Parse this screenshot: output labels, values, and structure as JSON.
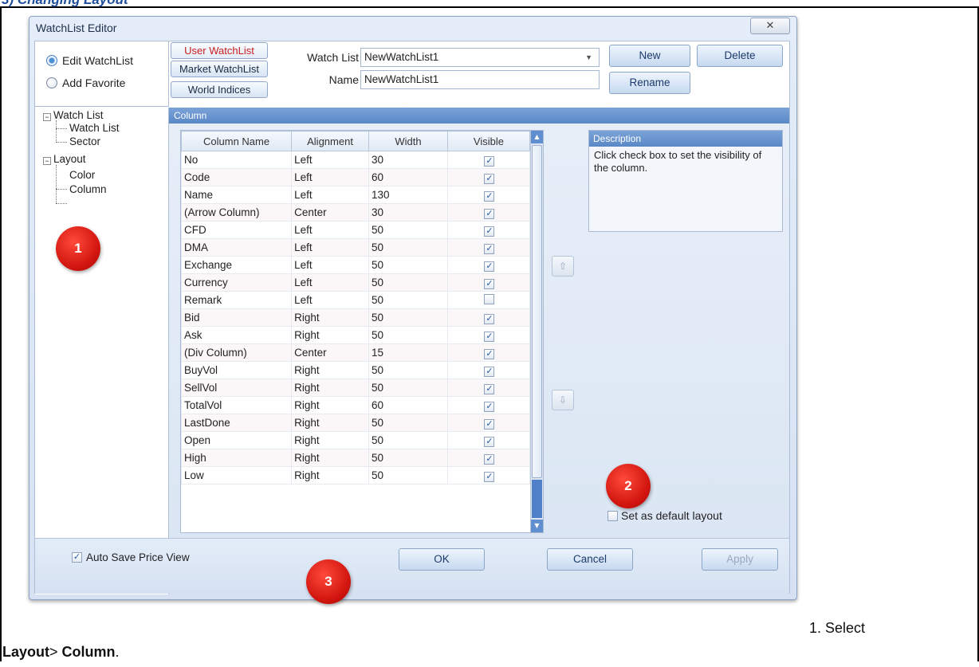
{
  "page": {
    "heading_fragment": "3) Changing Layout",
    "caption_step": "1. Select",
    "caption_path_bold1": "Layout",
    "caption_path_sep": ">",
    "caption_path_bold2": "Column",
    "caption_path_end": "."
  },
  "dialog": {
    "title": "WatchList Editor",
    "close_glyph": "✕",
    "radios": [
      {
        "label": "Edit WatchList",
        "checked": true
      },
      {
        "label": "Add Favorite",
        "checked": false
      }
    ],
    "tree": {
      "watch_list": "Watch List",
      "watch_list_child": "Watch List",
      "sector": "Sector",
      "layout": "Layout",
      "color": "Color",
      "column": "Column",
      "expander_glyph": "−"
    },
    "source_tabs": [
      "User WatchList",
      "Market WatchList",
      "World Indices"
    ],
    "watch_list_label": "Watch List",
    "watch_list_value": "NewWatchList1",
    "name_label": "Name",
    "name_value": "NewWatchList1",
    "buttons": {
      "new": "New",
      "delete": "Delete",
      "rename": "Rename",
      "ok": "OK",
      "cancel": "Cancel",
      "apply": "Apply"
    },
    "column_panel_title": "Column",
    "grid": {
      "headers": [
        "Column Name",
        "Alignment",
        "Width",
        "Visible"
      ],
      "rows": [
        {
          "name": "No",
          "align": "Left",
          "width": "30",
          "visible": true
        },
        {
          "name": "Code",
          "align": "Left",
          "width": "60",
          "visible": true
        },
        {
          "name": "Name",
          "align": "Left",
          "width": "130",
          "visible": true
        },
        {
          "name": "(Arrow Column)",
          "align": "Center",
          "width": "30",
          "visible": true
        },
        {
          "name": "CFD",
          "align": "Left",
          "width": "50",
          "visible": true
        },
        {
          "name": "DMA",
          "align": "Left",
          "width": "50",
          "visible": true
        },
        {
          "name": "Exchange",
          "align": "Left",
          "width": "50",
          "visible": true
        },
        {
          "name": "Currency",
          "align": "Left",
          "width": "50",
          "visible": true
        },
        {
          "name": "Remark",
          "align": "Left",
          "width": "50",
          "visible": false
        },
        {
          "name": "Bid",
          "align": "Right",
          "width": "50",
          "visible": true
        },
        {
          "name": "Ask",
          "align": "Right",
          "width": "50",
          "visible": true
        },
        {
          "name": "(Div Column)",
          "align": "Center",
          "width": "15",
          "visible": true
        },
        {
          "name": "BuyVol",
          "align": "Right",
          "width": "50",
          "visible": true
        },
        {
          "name": "SellVol",
          "align": "Right",
          "width": "50",
          "visible": true
        },
        {
          "name": "TotalVol",
          "align": "Right",
          "width": "60",
          "visible": true
        },
        {
          "name": "LastDone",
          "align": "Right",
          "width": "50",
          "visible": true
        },
        {
          "name": "Open",
          "align": "Right",
          "width": "50",
          "visible": true
        },
        {
          "name": "High",
          "align": "Right",
          "width": "50",
          "visible": true
        },
        {
          "name": "Low",
          "align": "Right",
          "width": "50",
          "visible": true
        }
      ]
    },
    "move_up_glyph": "⇧",
    "move_down_glyph": "⇩",
    "description_title": "Description",
    "description_text": "Click check box to set the visibility of the column.",
    "set_default_label": "Set as default layout",
    "set_default_checked": false,
    "auto_save_label": "Auto Save Price View",
    "auto_save_checked": true
  },
  "badges": [
    "1",
    "2",
    "3"
  ],
  "colors": {
    "active_tab": "#c61d1d",
    "header_blue": "#5a88c6",
    "badge_red": "#d0140e"
  }
}
